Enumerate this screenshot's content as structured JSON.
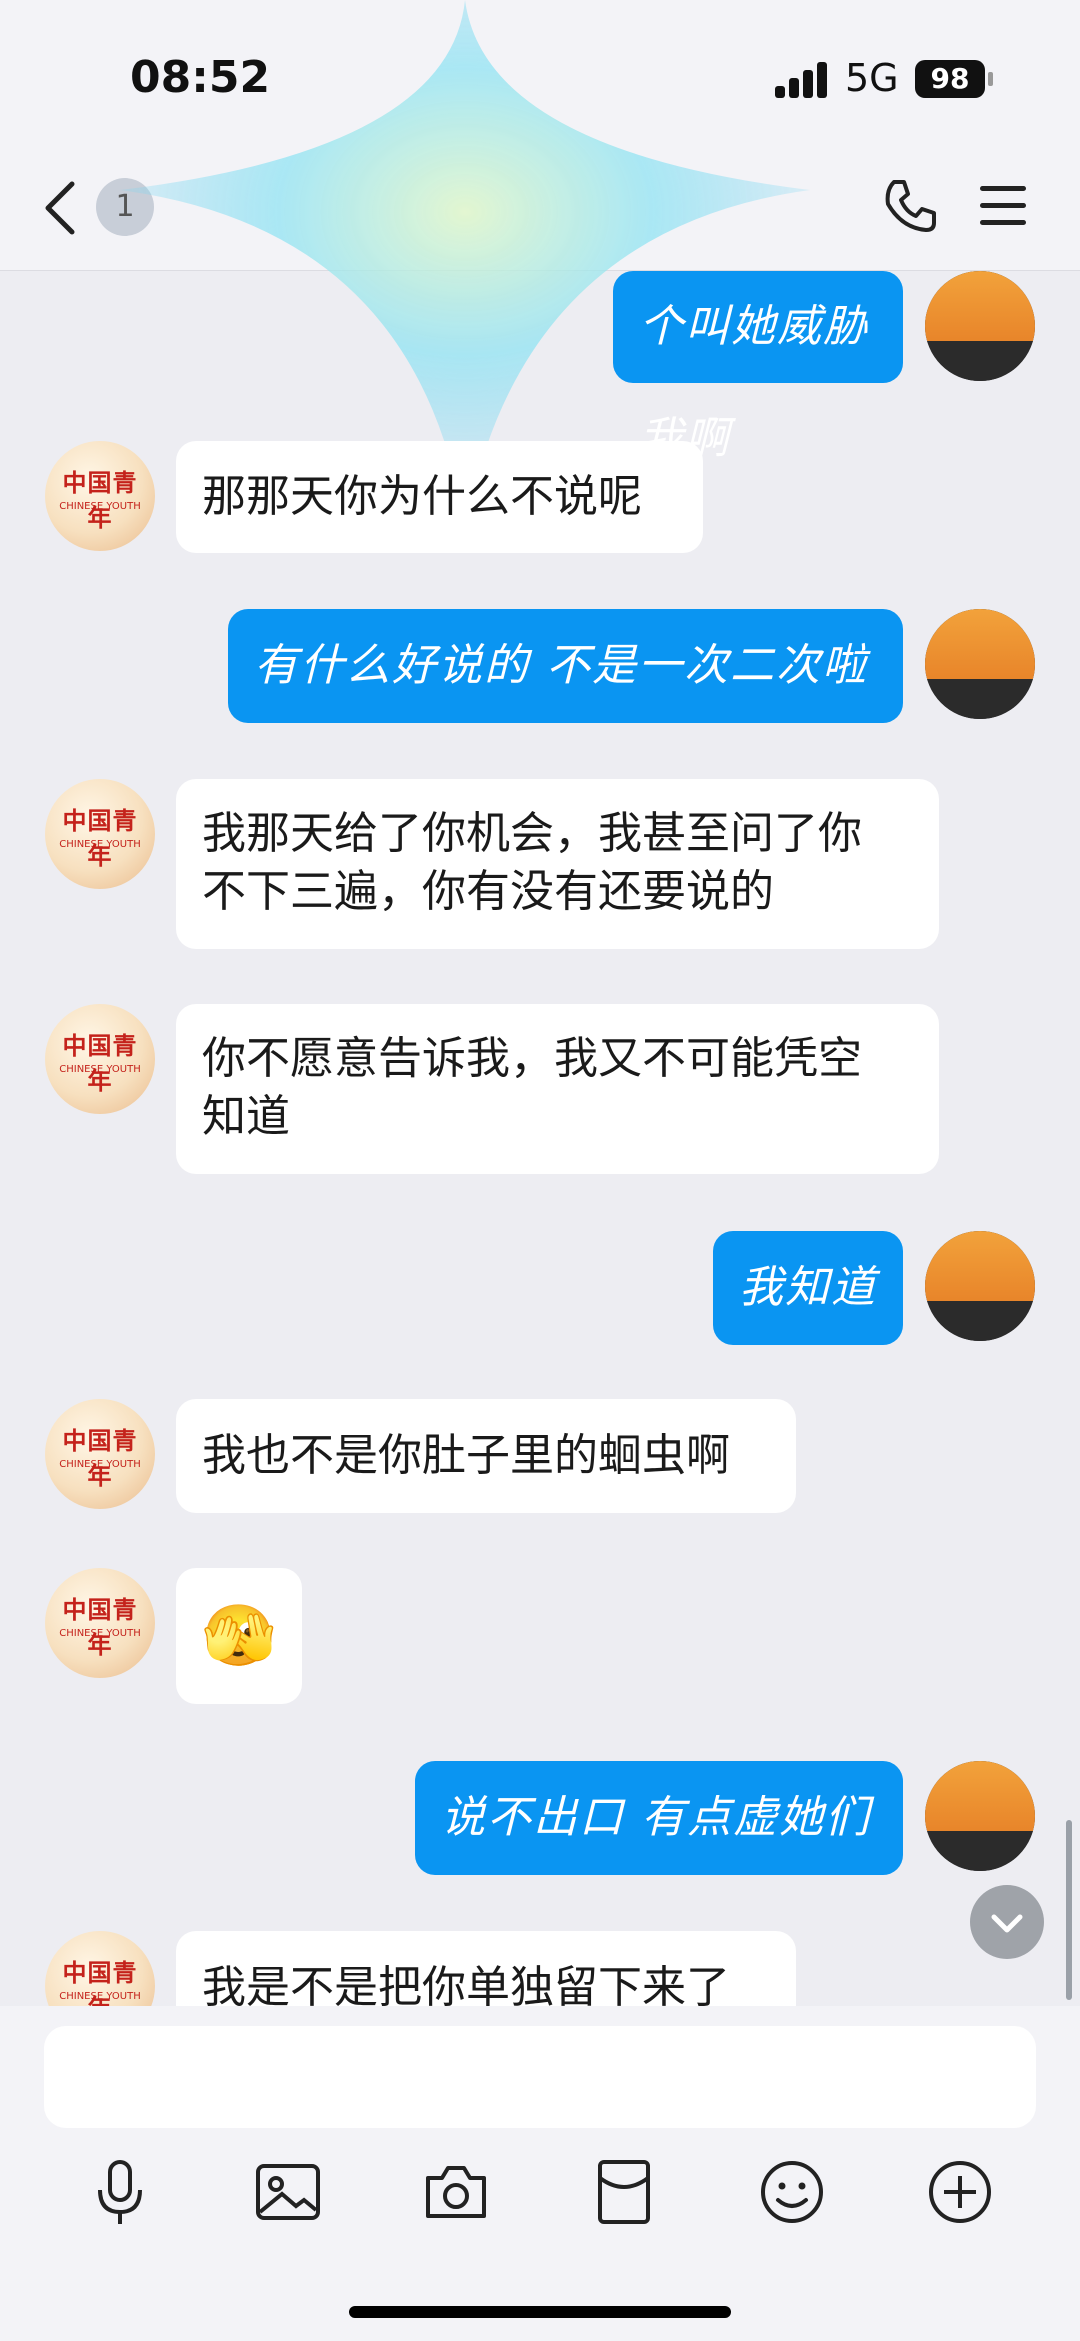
{
  "status": {
    "time": "08:52",
    "network": "5G",
    "battery": "98"
  },
  "nav": {
    "unread_badge": "1"
  },
  "messages": [
    {
      "side": "me",
      "text": "个叫她威胁我啊"
    },
    {
      "side": "other",
      "text": "那那天你为什么不说呢"
    },
    {
      "side": "me",
      "text": "有什么好说的 不是一次二次啦"
    },
    {
      "side": "other",
      "lines": [
        "我那天给了你机会，我甚至问了你",
        "不下三遍，你有没有还要说的"
      ]
    },
    {
      "side": "other",
      "lines": [
        "你不愿意告诉我，我又不可能凭空",
        "知道"
      ]
    },
    {
      "side": "me",
      "text": "我知道"
    },
    {
      "side": "other",
      "text": "我也不是你肚子里的蛔虫啊"
    },
    {
      "side": "other",
      "emoji": "🫣"
    },
    {
      "side": "me",
      "text": "说不出口 有点虚她们"
    },
    {
      "side": "other",
      "text": "我是不是把你单独留下来了"
    }
  ],
  "avatar_text": {
    "line1": "中国青年",
    "line2": "CHINESE YOUTH"
  },
  "toolbar": {
    "icons": [
      "microphone-icon",
      "image-icon",
      "camera-icon",
      "red-packet-icon",
      "emoji-icon",
      "add-icon"
    ]
  },
  "colors": {
    "my_bubble": "#0a95f2",
    "other_bubble": "#ffffff",
    "background": "#ededf2"
  }
}
